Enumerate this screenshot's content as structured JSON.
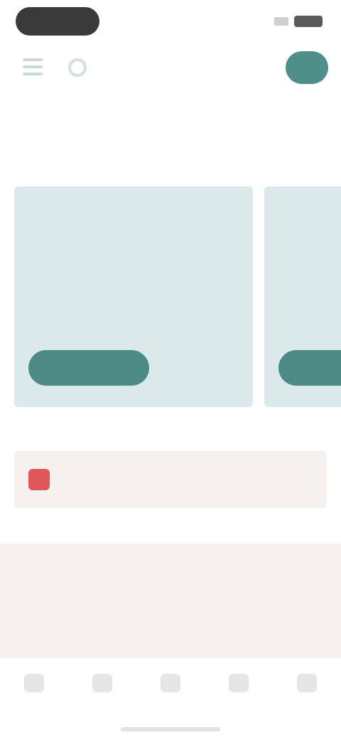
{
  "status_bar": {
    "time": ""
  },
  "header": {
    "logo": ""
  },
  "section": {
    "title": "",
    "subtitle": ""
  },
  "cards": [
    {
      "kicker": "",
      "title": "",
      "description": "",
      "button": ""
    },
    {
      "kicker": "",
      "title": "",
      "description": "",
      "button": ""
    }
  ],
  "alert": {
    "text": "",
    "action": ""
  },
  "promo": {
    "title": "",
    "subtitle": ""
  },
  "nav": [
    {
      "label": ""
    },
    {
      "label": ""
    },
    {
      "label": ""
    },
    {
      "label": ""
    },
    {
      "label": ""
    }
  ],
  "colors": {
    "accent": "#4e8a85",
    "card_bg": "#dbe9ea",
    "alert_icon": "#e0565b",
    "promo_bg": "#f6f1ee"
  }
}
